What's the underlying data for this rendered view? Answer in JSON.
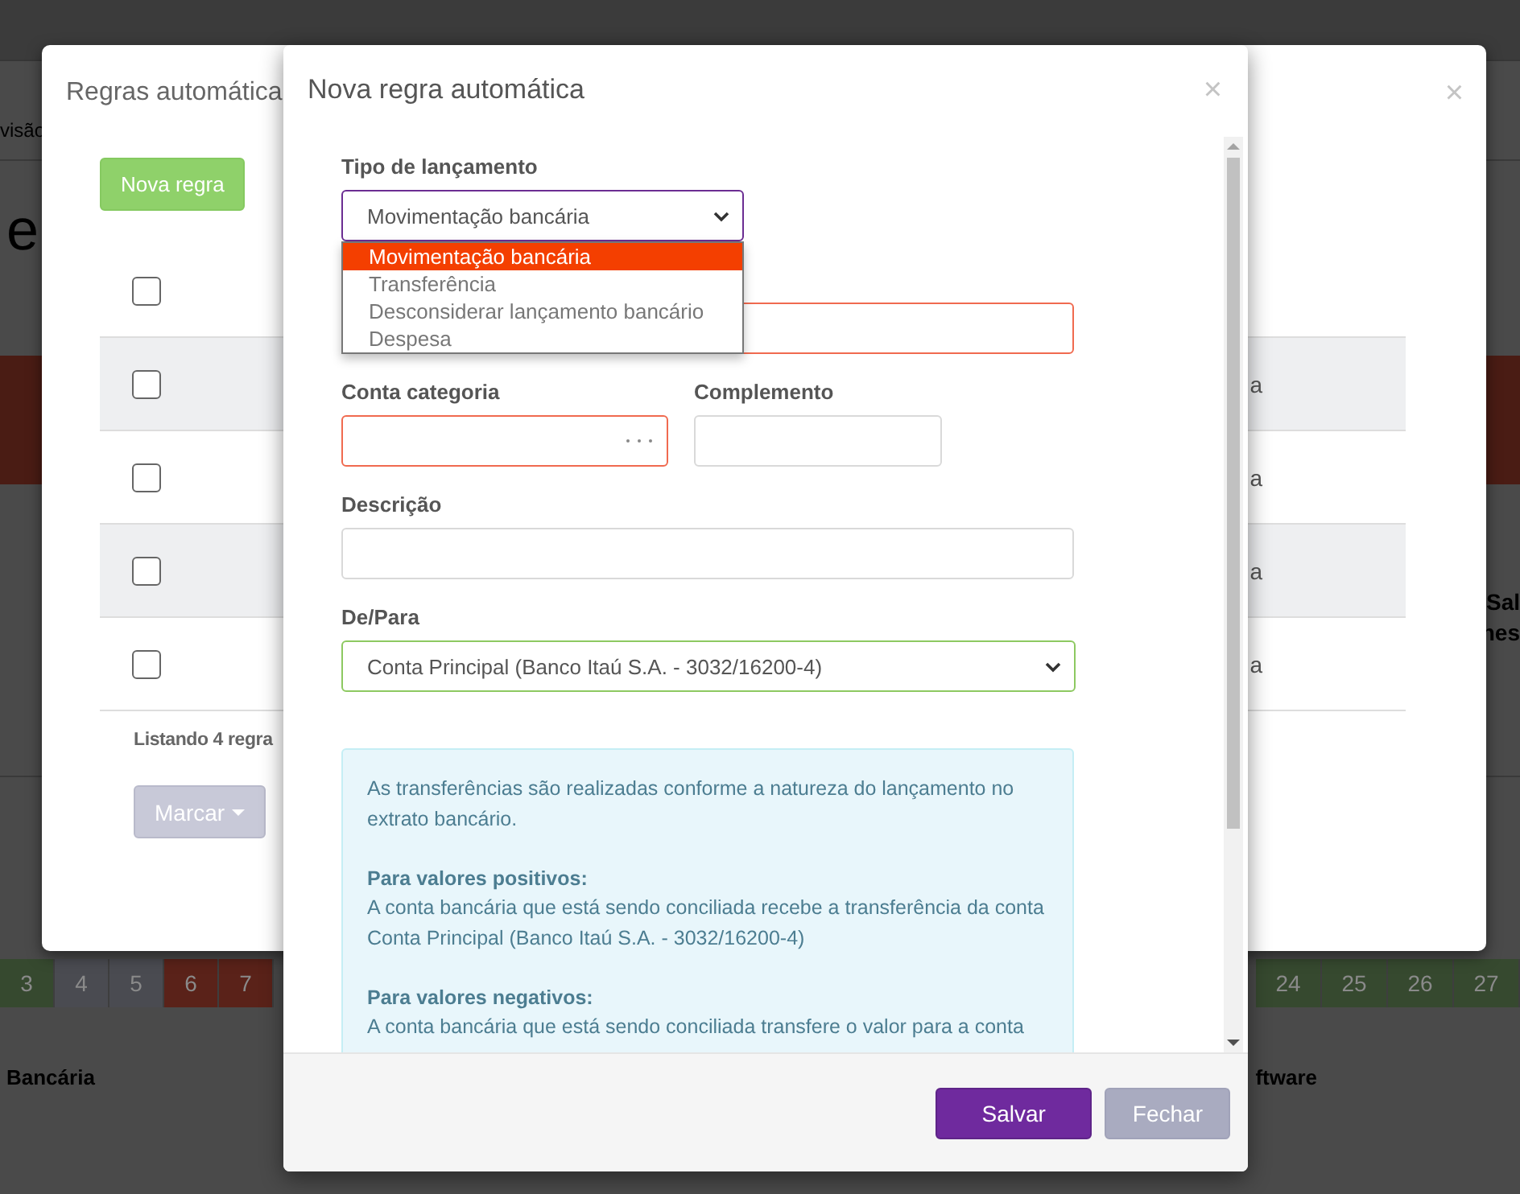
{
  "page": {
    "breadcrumb": "visão",
    "heading": "e",
    "side_lines": [
      "Sal",
      "nes"
    ],
    "calendar_left": [
      {
        "label": "3",
        "color": "#36492f"
      },
      {
        "label": "4",
        "color": "#4a4b51"
      },
      {
        "label": "5",
        "color": "#4a4b51"
      },
      {
        "label": "6",
        "color": "#5a2219"
      },
      {
        "label": "7",
        "color": "#5a2219"
      }
    ],
    "calendar_right": [
      {
        "label": "24",
        "color": "#36492f"
      },
      {
        "label": "25",
        "color": "#36492f"
      },
      {
        "label": "26",
        "color": "#36492f"
      },
      {
        "label": "27",
        "color": "#36492f"
      }
    ],
    "footer_left": "Bancária",
    "footer_right": "ftware"
  },
  "rules_dialog": {
    "title": "Regras automática",
    "close": "×",
    "new_button": "Nova regra",
    "header_checked": false,
    "rows": [
      {
        "checked": false,
        "cell": "a"
      },
      {
        "checked": false,
        "cell": "a"
      },
      {
        "checked": false,
        "cell": "a"
      },
      {
        "checked": false,
        "cell": "a"
      }
    ],
    "count": "Listando 4 regra",
    "mark_button": "Marcar"
  },
  "rule_dialog": {
    "title": "Nova regra automática",
    "close": "×",
    "field_rows": [
      [
        {
          "label": "Tipo de lançamento",
          "kind": "select",
          "focused": true,
          "error": false,
          "valid": false,
          "value": "Movimentação bancária",
          "expanded": true,
          "options": [
            {
              "label": "Movimentação bancária",
              "selected": true
            },
            {
              "label": "Transferência",
              "selected": false
            },
            {
              "label": "Desconsiderar lançamento bancário",
              "selected": false
            },
            {
              "label": "Despesa",
              "selected": false
            }
          ]
        }
      ],
      [
        {
          "kind": "text",
          "focused": false,
          "error": true,
          "valid": false
        }
      ],
      [
        {
          "label": "Conta categoria",
          "kind": "lookup",
          "focused": false,
          "error": true,
          "valid": false
        },
        {
          "label": "Complemento",
          "kind": "text",
          "focused": false,
          "error": false,
          "valid": false
        }
      ],
      [
        {
          "label": "Descrição",
          "kind": "text",
          "focused": false,
          "error": false,
          "valid": false
        }
      ],
      [
        {
          "label": "De/Para",
          "kind": "select",
          "focused": false,
          "error": false,
          "valid": true,
          "value": "Conta Principal (Banco Itaú S.A. - 3032/16200-4)",
          "expanded": false
        }
      ]
    ],
    "info": [
      {
        "text": "As transferências são realizadas conforme a natureza do lançamento no extrato bancário."
      },
      {
        "heading": "Para valores positivos:",
        "text": "A conta bancária que está sendo conciliada recebe a transferência da conta Conta Principal (Banco Itaú S.A. - 3032/16200-4)"
      },
      {
        "heading": "Para valores negativos:",
        "text": "A conta bancária que está sendo conciliada transfere o valor para a conta"
      }
    ],
    "buttons": [
      {
        "label": "Salvar",
        "kind": "primary",
        "disabled": false
      },
      {
        "label": "Fechar",
        "kind": "secondary",
        "disabled": true
      }
    ]
  }
}
